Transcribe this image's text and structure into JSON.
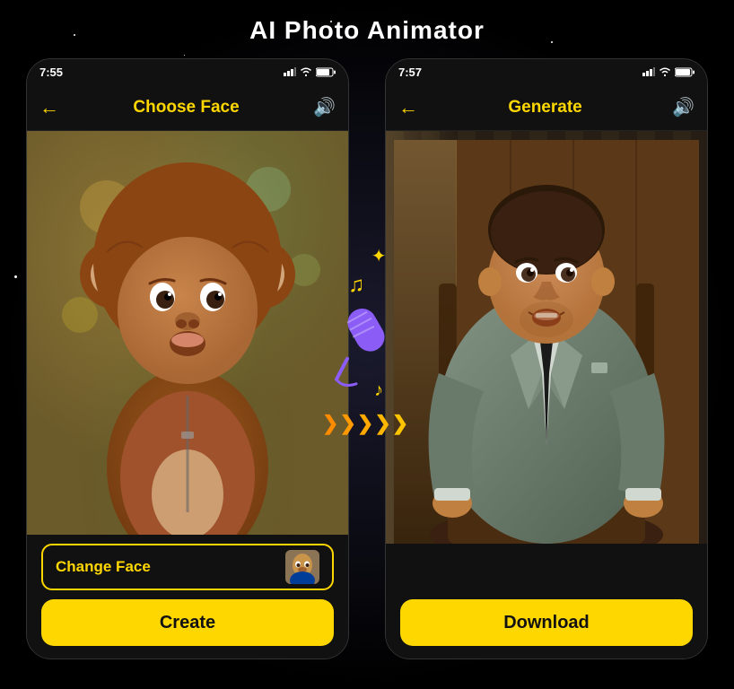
{
  "app": {
    "title": "AI Photo Animator",
    "background": "#000000"
  },
  "left_phone": {
    "status": {
      "time": "7:55",
      "icons": [
        "signal",
        "wifi",
        "battery"
      ]
    },
    "header": {
      "back_label": "←",
      "title": "Choose Face",
      "sound_label": "🔊"
    },
    "change_face_button": "Change Face",
    "create_button": "Create"
  },
  "right_phone": {
    "status": {
      "time": "7:57",
      "icons": [
        "signal",
        "wifi",
        "battery"
      ]
    },
    "header": {
      "back_label": "←",
      "title": "Generate",
      "sound_label": "🔊"
    },
    "download_button": "Download"
  },
  "overlay": {
    "music_note1": "♪",
    "music_note2": "♫",
    "sparkle": "✦",
    "arrows": [
      "❯",
      "❯",
      "❯",
      "❯",
      "❯"
    ]
  },
  "colors": {
    "gold": "#FFD700",
    "dark_bg": "#111111",
    "border_gold": "#FFD700",
    "arrow_orange": "#FF8C00",
    "purple": "#8B5CF6"
  }
}
